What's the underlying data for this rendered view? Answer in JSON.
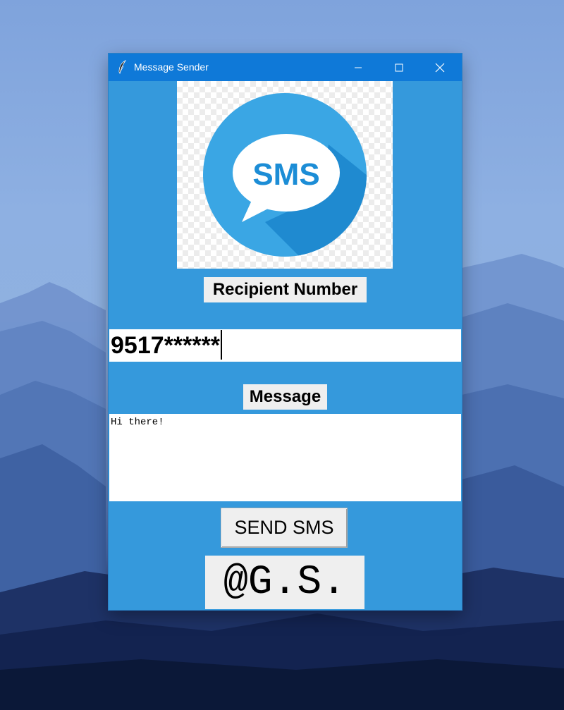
{
  "window": {
    "title": "Message Sender",
    "accent_color": "#3599dc",
    "titlebar_color": "#0f79d8"
  },
  "logo": {
    "text": "SMS",
    "circle_color": "#3aa6e4",
    "shadow_color": "#1f8ad0"
  },
  "recipient": {
    "label": "Recipient Number",
    "value": "9517******"
  },
  "message": {
    "label": "Message",
    "value": "Hi there!"
  },
  "send_button": {
    "label": "SEND SMS"
  },
  "signature": {
    "text": "@G.S."
  },
  "icons": {
    "app": "feather-icon",
    "minimize": "minimize-icon",
    "maximize": "maximize-icon",
    "close": "close-icon"
  }
}
